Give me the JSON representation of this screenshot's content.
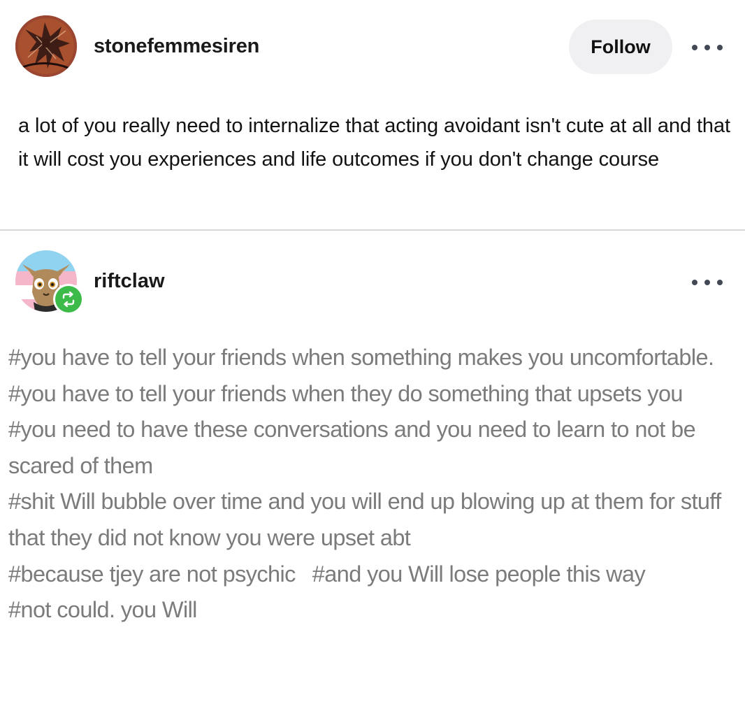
{
  "post": {
    "username": "stonefemmesiren",
    "follow_label": "Follow",
    "body": "a lot of you really need to internalize that acting avoidant isn't cute at all and that it will cost you experiences and life outcomes if you don't change course"
  },
  "reblog": {
    "username": "riftclaw",
    "tags": [
      "#you have to tell your friends when something makes you uncomfortable.",
      "#you have to tell your friends when they do something that upsets you",
      "#you need to have these conversations and you need to learn to not be scared of them",
      "#shit Will bubble over time and you will end up blowing up at them for stuff that they did not know you were upset abt",
      "#because tjey are not psychic",
      "#and you Will lose people this way",
      "#not could. you Will"
    ]
  },
  "icons": {
    "more": "ellipsis-icon",
    "reblog": "reblog-icon"
  },
  "colors": {
    "follow_bg": "#f0f0f2",
    "reblog_green": "#3dbb4a",
    "tag_text": "#7b7b7b",
    "divider": "#d8d8d8"
  }
}
